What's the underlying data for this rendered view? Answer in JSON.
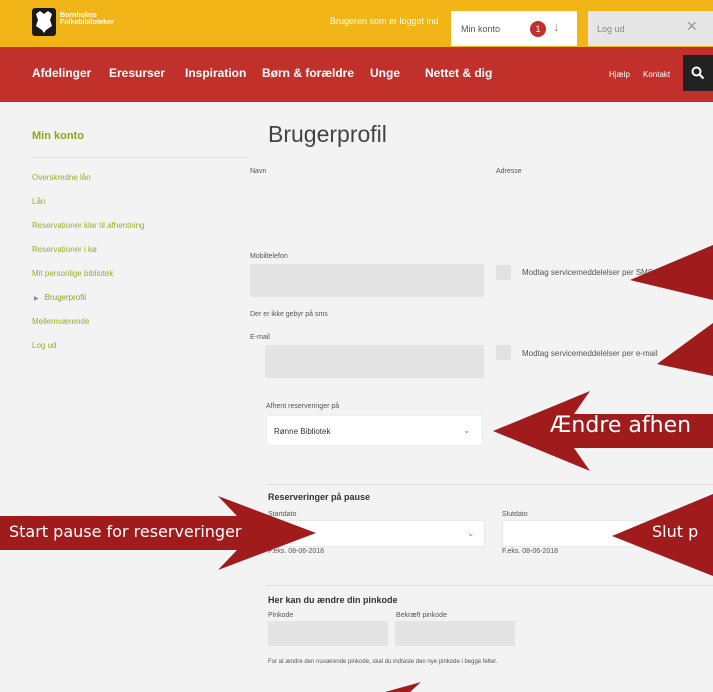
{
  "brand": {
    "name_line1": "Bornholms",
    "name_line2": "Folkebiblioteker"
  },
  "topbar": {
    "logged_in_text": "Brugeren som er logget ind",
    "account_label": "Min konto",
    "account_badge": "1",
    "logout_label": "Log ud"
  },
  "nav": {
    "items": [
      "Afdelinger",
      "Eresurser",
      "Inspiration",
      "Børn & forældre",
      "Unge",
      "Nettet & dig"
    ],
    "help": "Hjælp",
    "contact": "Kontakt"
  },
  "sidebar": {
    "title": "Min konto",
    "links": [
      "Overskredne lån",
      "Lån",
      "Reservationer klar til afhentning",
      "Reservationer i kø",
      "Mit personlige bibliotek",
      "Brugerprofil",
      "Mellemværende",
      "Log ud"
    ],
    "active": "Brugerprofil"
  },
  "profile": {
    "title": "Brugerprofil",
    "name_label": "Navn",
    "address_label": "Adresse",
    "mobile_label": "Mobiltelefon",
    "sms_checkbox_label": "Modtag servicemeddelelser per SMS",
    "sms_note": "Der er ikke gebyr på sms",
    "email_label": "E-mail",
    "email_checkbox_label": "Modtag servicemeddelelser per e-mail",
    "pickup_label": "Afhent reserveringer på",
    "pickup_value": "Rønne Bibliotek",
    "pause_heading": "Reserveringer på pause",
    "start_label": "Startdato",
    "end_label": "Slutdato",
    "start_hint": "F.eks. 08-06-2018",
    "end_hint": "F.eks. 08-06-2018",
    "pin_heading": "Her kan du ændre din pinkode",
    "pin_label": "Pinkode",
    "pin_confirm_label": "Bekræft pinkode",
    "pin_note": "For at ændre den nuværende pinkode, skal du indtaste den nye pinkode i begge felter."
  },
  "annotations": {
    "pickup_arrow_text": "Ændre afhen",
    "start_pause_text": "Start pause for reserveringer",
    "end_pause_text": "Slut p",
    "arrow_color": "#a01c1c"
  }
}
